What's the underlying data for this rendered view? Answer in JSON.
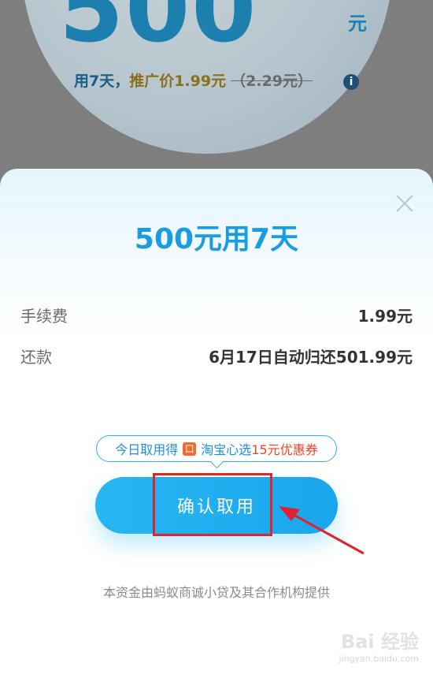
{
  "background": {
    "amount": "500",
    "unit": "元",
    "promo_days": "用7天，",
    "promo_price": "推广价1.99元",
    "promo_old_price": "（2.29元）",
    "info_icon": "info-icon"
  },
  "sheet": {
    "title": "500元用7天",
    "fee_label": "手续费",
    "fee_value": "1.99元",
    "repay_label": "还款",
    "repay_value": "6月17日自动归还501.99元",
    "coupon_prefix": "今日取用得",
    "coupon_brand": "淘宝心选",
    "coupon_highlight": "15元",
    "coupon_suffix": "优惠券",
    "confirm_label": "确认取用",
    "footer_text": "本资金由蚂蚁商诚小贷及其合作机构提供"
  },
  "watermark": {
    "main": "Bai 经验",
    "sub": "jingyan.baidu.com"
  },
  "colors": {
    "accent": "#1a9ce3",
    "button": "#1aa6ec",
    "highlight_red": "#e0232e",
    "coupon_red": "#e9442b"
  }
}
